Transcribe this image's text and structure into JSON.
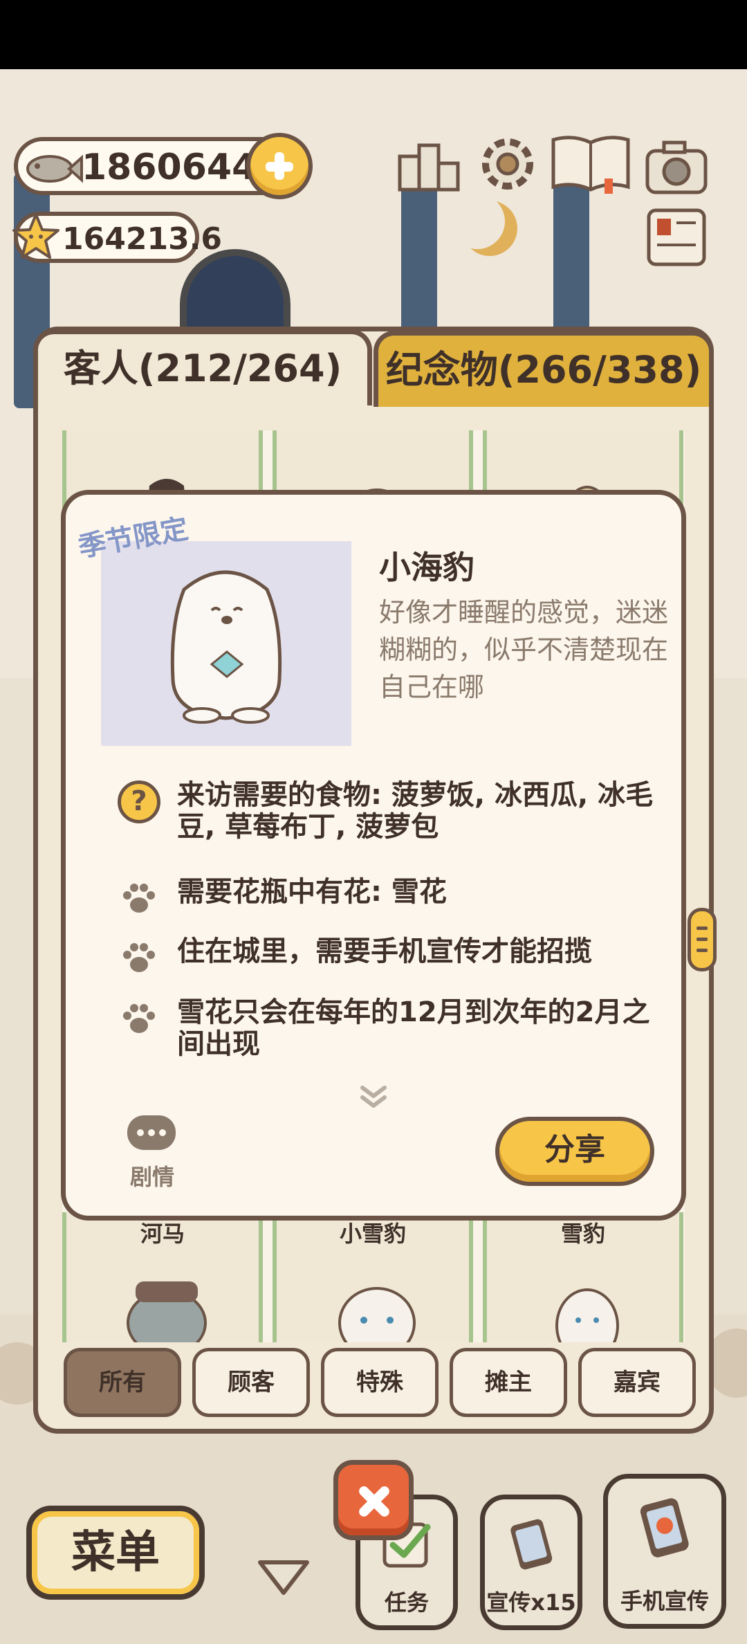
{
  "currency": {
    "fish": "18606440",
    "stars": "164213.6"
  },
  "tabs": [
    {
      "label": "客人(212/264)",
      "active": true
    },
    {
      "label": "纪念物(266/338)",
      "active": false
    }
  ],
  "grid": {
    "bottom_cards": [
      "河马",
      "小雪豹",
      "雪豹"
    ]
  },
  "detail": {
    "season_tag": "季节限定",
    "name": "小海豹",
    "description": "好像才睡醒的感觉，迷迷糊糊的，似乎不清楚现在自己在哪",
    "requirements": [
      {
        "icon": "question-icon",
        "text": "来访需要的食物: 菠萝饭, 冰西瓜, 冰毛豆, 草莓布丁, 菠萝包"
      },
      {
        "icon": "paw-icon",
        "text": "需要花瓶中有花: 雪花"
      },
      {
        "icon": "paw-icon",
        "text": "住在城里，需要手机宣传才能招揽"
      },
      {
        "icon": "paw-icon",
        "text": "雪花只会在每年的12月到次年的2月之间出现"
      }
    ],
    "story_label": "剧情",
    "share_label": "分享"
  },
  "filters": [
    {
      "label": "所有",
      "active": true
    },
    {
      "label": "顾客",
      "active": false
    },
    {
      "label": "特殊",
      "active": false
    },
    {
      "label": "摊主",
      "active": false
    },
    {
      "label": "嘉宾",
      "active": false
    }
  ],
  "hud": {
    "menu_label": "菜单",
    "task_label": "任务",
    "promo_label": "宣传x15",
    "phone_promo_label": "手机宣传"
  },
  "colors": {
    "accent_yellow": "#f7c548",
    "outline_brown": "#6b5445",
    "panel": "#f2e8d6",
    "close_red": "#e8663c",
    "season_blue": "#8496c8"
  }
}
